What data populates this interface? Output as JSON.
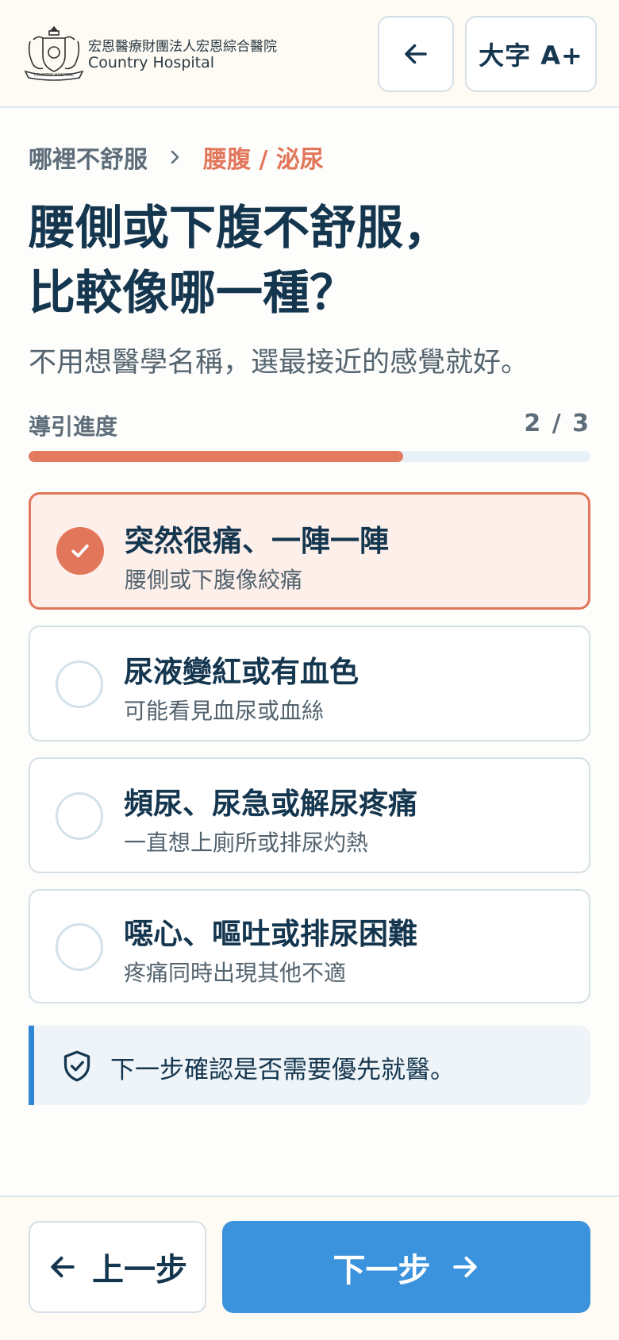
{
  "header": {
    "brand_cn": "宏恩醫療財團法人宏恩綜合醫院",
    "brand_en": "Country Hospital",
    "logo_icon": "hospital-crest-icon",
    "back_icon": "arrow-left-icon",
    "font_size_label": "大字 A+"
  },
  "breadcrumb": {
    "home": "哪裡不舒服",
    "current": "腰腹 / 泌尿"
  },
  "question": {
    "title_line1": "腰側或下腹不舒服，",
    "title_line2": "比較像哪一種？",
    "subtitle": "不用想醫學名稱，選最接近的感覺就好。"
  },
  "progress": {
    "label": "導引進度",
    "text": "2 / 3",
    "fraction": 0.667
  },
  "options": [
    {
      "title": "突然很痛、一陣一陣",
      "desc": "腰側或下腹像絞痛",
      "selected": true
    },
    {
      "title": "尿液變紅或有血色",
      "desc": "可能看見血尿或血絲",
      "selected": false
    },
    {
      "title": "頻尿、尿急或解尿疼痛",
      "desc": "一直想上廁所或排尿灼熱",
      "selected": false
    },
    {
      "title": "噁心、嘔吐或排尿困難",
      "desc": "疼痛同時出現其他不適",
      "selected": false
    }
  ],
  "notice": {
    "icon": "shield-check-icon",
    "text": "下一步確認是否需要優先就醫。"
  },
  "footer": {
    "prev_label": "上一步",
    "next_label": "下一步"
  },
  "colors": {
    "accent": "#e2765a",
    "primary": "#3b92dd",
    "text": "#15364f"
  }
}
